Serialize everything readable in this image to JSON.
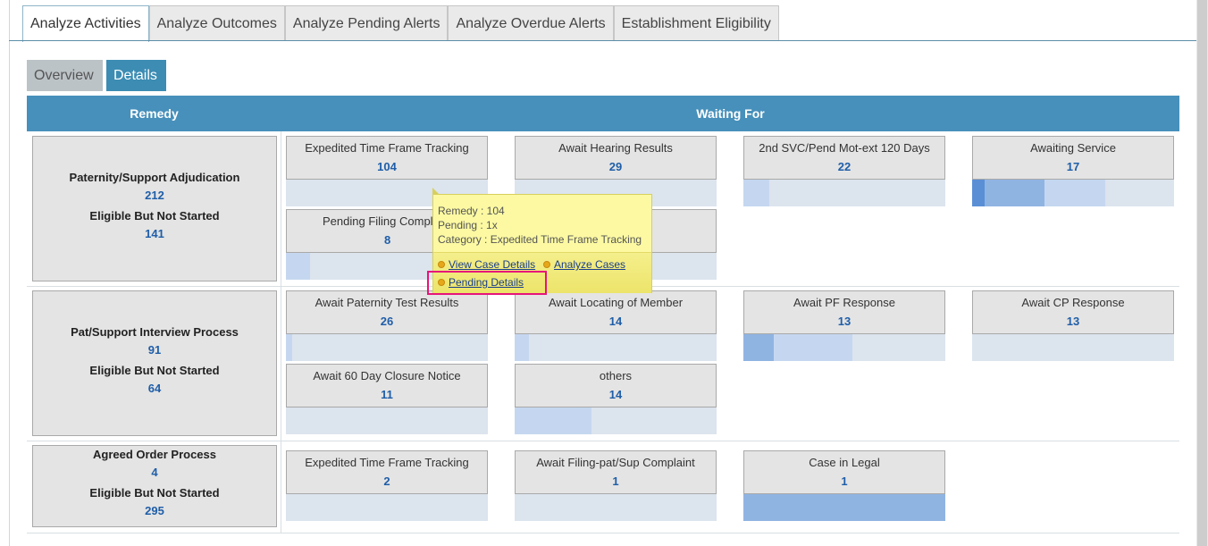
{
  "tabs": [
    "Analyze Activities",
    "Analyze Outcomes",
    "Analyze Pending Alerts",
    "Analyze Overdue Alerts",
    "Establishment Eligibility"
  ],
  "subtabs": {
    "overview": "Overview",
    "details": "Details"
  },
  "table": {
    "col_remedy": "Remedy",
    "col_waiting": "Waiting For"
  },
  "rows": [
    {
      "remedy": {
        "name": "Paternity/Support Adjudication",
        "count": "212",
        "eligible_label": "Eligible But Not Started",
        "eligible_count": "141"
      },
      "waiting": [
        {
          "label": "Expedited Time Frame Tracking",
          "count": "104",
          "bar": []
        },
        {
          "label": "Await Hearing Results",
          "count": "29",
          "bar": []
        },
        {
          "label": "2nd SVC/Pend Mot-ext 120 Days",
          "count": "22",
          "bar": [
            {
              "start": 0,
              "width": 0.13,
              "color": "#c5d7f0"
            }
          ]
        },
        {
          "label": "Awaiting Service",
          "count": "17",
          "bar": [
            {
              "start": 0,
              "width": 0.06,
              "color": "#5a8fd6"
            },
            {
              "start": 0.06,
              "width": 0.3,
              "color": "#90b4e2"
            },
            {
              "start": 0.36,
              "width": 0.3,
              "color": "#c5d7f0"
            }
          ]
        },
        {
          "label": "Pending Filing Compl",
          "count": "8",
          "bar": [
            {
              "start": 0,
              "width": 0.12,
              "color": "#c5d7f0"
            }
          ]
        },
        {
          "label": "",
          "count": "",
          "bar": []
        }
      ]
    },
    {
      "remedy": {
        "name": "Pat/Support Interview Process",
        "count": "91",
        "eligible_label": "Eligible But Not Started",
        "eligible_count": "64"
      },
      "waiting": [
        {
          "label": "Await Paternity Test Results",
          "count": "26",
          "bar": [
            {
              "start": 0,
              "width": 0.03,
              "color": "#c5d7f0"
            }
          ]
        },
        {
          "label": "Await Locating of Member",
          "count": "14",
          "bar": [
            {
              "start": 0,
              "width": 0.07,
              "color": "#c5d7f0"
            }
          ]
        },
        {
          "label": "Await PF Response",
          "count": "13",
          "bar": [
            {
              "start": 0,
              "width": 0.15,
              "color": "#90b4e2"
            },
            {
              "start": 0.15,
              "width": 0.39,
              "color": "#c5d7f0"
            }
          ]
        },
        {
          "label": "Await CP Response",
          "count": "13",
          "bar": []
        },
        {
          "label": "Await 60 Day Closure Notice",
          "count": "11",
          "bar": []
        },
        {
          "label": "others",
          "count": "14",
          "bar": [
            {
              "start": 0,
              "width": 0.38,
              "color": "#c5d7f0"
            }
          ]
        }
      ]
    },
    {
      "remedy": {
        "name": "Agreed Order Process",
        "count": "4",
        "eligible_label": "Eligible But Not Started",
        "eligible_count": "295"
      },
      "waiting": [
        {
          "label": "Expedited Time Frame Tracking",
          "count": "2",
          "bar": []
        },
        {
          "label": "Await Filing-pat/Sup Complaint",
          "count": "1",
          "bar": []
        },
        {
          "label": "Case in Legal",
          "count": "1",
          "bar": [
            {
              "start": 0,
              "width": 1.0,
              "color": "#90b4e2"
            }
          ]
        }
      ]
    }
  ],
  "tooltip": {
    "line1": "Remedy : 104",
    "line2": "Pending : 1x",
    "line3": "Category : Expedited Time Frame Tracking",
    "view_case": "View Case Details",
    "analyze_cases": "Analyze Cases",
    "pending_details": "Pending Details"
  }
}
